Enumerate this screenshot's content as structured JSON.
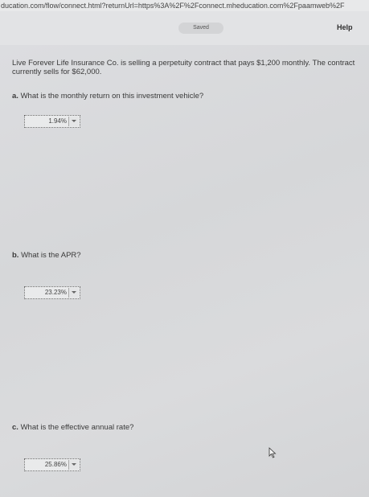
{
  "browser": {
    "url": "ducation.com/flow/connect.html?returnUrl=https%3A%2F%2Fconnect.mheducation.com%2Fpaamweb%2F"
  },
  "header": {
    "saved_label": "Saved",
    "help_label": "Help"
  },
  "question": {
    "text": "Live Forever Life Insurance Co. is selling a perpetuity contract that pays $1,200 monthly. The contract currently sells for $62,000."
  },
  "parts": [
    {
      "letter": "a.",
      "prompt": "What is the monthly return on this investment vehicle?",
      "selected": "1.94%"
    },
    {
      "letter": "b.",
      "prompt": "What is the APR?",
      "selected": "23.23%"
    },
    {
      "letter": "c.",
      "prompt": "What is the effective annual rate?",
      "selected": "25.86%"
    }
  ],
  "icons": {
    "dropdown": "chevron-down-icon",
    "cursor": "mouse-pointer-icon"
  }
}
